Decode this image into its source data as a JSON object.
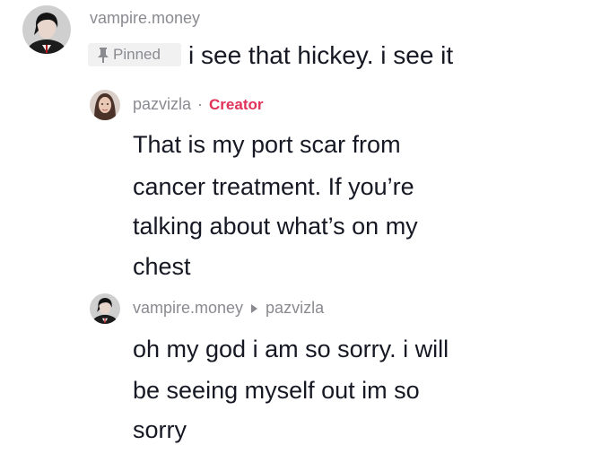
{
  "comments": [
    {
      "username": "vampire.money",
      "pinned_label": "Pinned",
      "text": "i see that hickey. i see it"
    },
    {
      "username": "pazvizla",
      "separator": "·",
      "creator_label": "Creator",
      "lines": [
        "That is my port scar from",
        "cancer treatment. If you’re",
        "talking about what’s on my",
        "chest"
      ]
    },
    {
      "username": "vampire.money",
      "reply_to": "pazvizla",
      "lines": [
        "oh my god i am so sorry. i will",
        "be seeing myself out im so",
        "sorry"
      ]
    }
  ],
  "icons": {
    "pin": "pin-icon",
    "reply_arrow": "reply-arrow-icon"
  },
  "colors": {
    "text": "#161823",
    "secondary": "#8a8b91",
    "creator": "#e1325a",
    "badge_bg": "#f1f1f2"
  }
}
